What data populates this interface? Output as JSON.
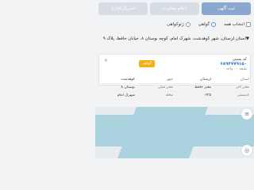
{
  "tabs": [
    {
      "label": "ثبت آگهی",
      "active": true
    },
    {
      "label": "اعلام مغایرت",
      "active": false
    },
    {
      "label": "اشتراک‌گذاری",
      "active": false
    }
  ],
  "options": {
    "select_all": "انتخاب همه",
    "certificate": "گواهی",
    "no_certificate": "ژئوکواهی"
  },
  "address_text": "▼استان لرستان، شهر کوهدشت، شهرک امام، کوچه بوستان ۸، خیابان حافظ، پلاک ۹",
  "card": {
    "title": "کد پستی",
    "code": "۶۸۹۴۷۷۹۱۵۰",
    "floor": "طبقه ۰ · واحد ۰",
    "badge": "گواهی",
    "close_icon": "close-icon"
  },
  "table": [
    [
      "استان",
      "لرستان",
      "شهر",
      "کوهدشت"
    ],
    [
      "معبر آخر",
      "معبر حافظ",
      "معبر قبلی",
      "بوستان ۸"
    ],
    [
      "کدپستی",
      "۰۶۲۵",
      "محله",
      "شهرک امام"
    ]
  ],
  "map": {
    "layers_icon": "layers-icon",
    "locate_icon": "locate-icon",
    "water_color": "#aad3df"
  }
}
